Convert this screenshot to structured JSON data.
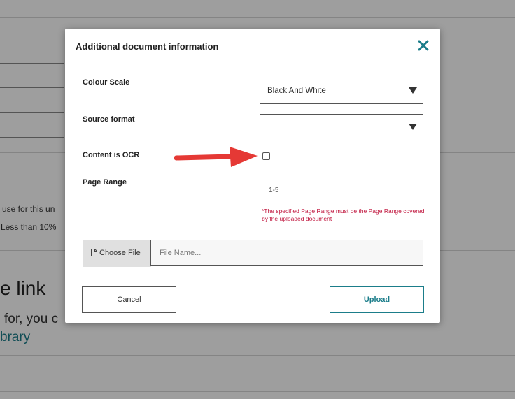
{
  "background": {
    "partial_text_1": "use for this un",
    "partial_text_2": "Less than 10%",
    "partial_heading": "e link",
    "partial_body": "for, you c",
    "partial_link": "brary"
  },
  "modal": {
    "title": "Additional document information",
    "close_icon": "close-icon",
    "colour_scale": {
      "label": "Colour Scale",
      "selected": "Black And White"
    },
    "source_format": {
      "label": "Source format",
      "selected": ""
    },
    "ocr": {
      "label": "Content is OCR",
      "checked": false
    },
    "page_range": {
      "label": "Page Range",
      "value": "1-5",
      "warning": "*The specified Page Range must be the Page Range covered by the uploaded document"
    },
    "file": {
      "choose_label": "Choose File",
      "placeholder": "File Name..."
    },
    "cancel_label": "Cancel",
    "upload_label": "Upload"
  },
  "colors": {
    "accent": "#1b7d8a",
    "warning": "#c0143c",
    "arrow": "#e53935"
  }
}
